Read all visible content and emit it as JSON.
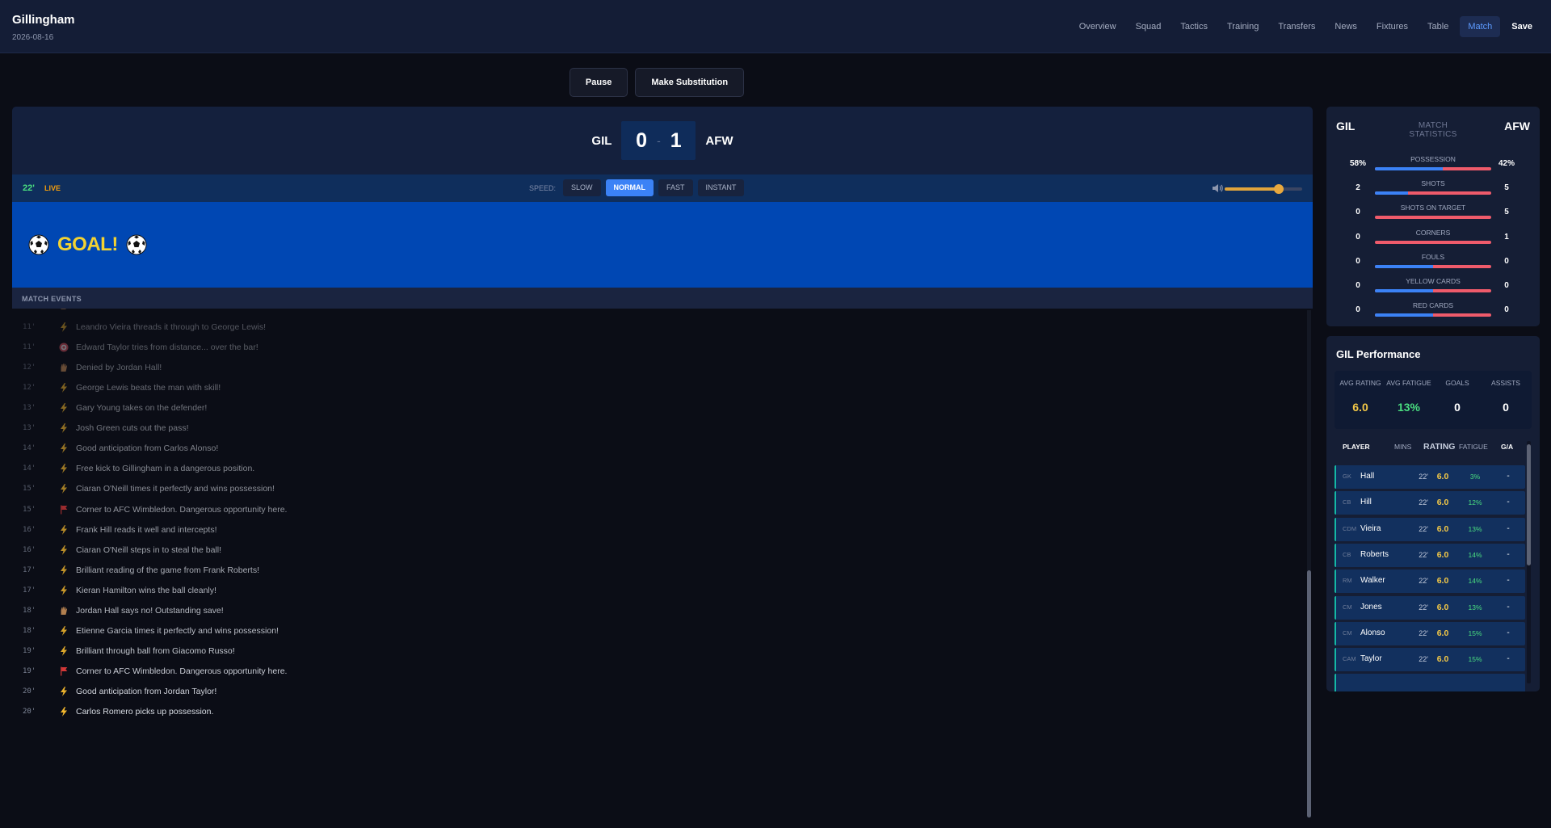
{
  "header": {
    "club_name": "Gillingham",
    "date": "2026-08-16",
    "nav": [
      "Overview",
      "Squad",
      "Tactics",
      "Training",
      "Transfers",
      "News",
      "Fixtures",
      "Table",
      "Match",
      "Save"
    ],
    "active_nav": "Match"
  },
  "controls": {
    "pause_label": "Pause",
    "substitution_label": "Make Substitution"
  },
  "match": {
    "home_code": "GIL",
    "away_code": "AFW",
    "home_score": "0",
    "score_separator": "-",
    "away_score": "1",
    "minute": "22'",
    "live_label": "LIVE",
    "speed_label": "SPEED:",
    "speeds": [
      "SLOW",
      "NORMAL",
      "FAST",
      "INSTANT"
    ],
    "active_speed": "NORMAL",
    "volume_level": 0.7,
    "goal_text": "GOAL!",
    "events_title": "MATCH EVENTS"
  },
  "events": [
    {
      "min": "11'",
      "icon": "bolt-icon",
      "text": "Leandro Vieira threads it through to George Lewis!"
    },
    {
      "min": "11'",
      "icon": "target-icon",
      "text": "Edward Taylor tries from distance... over the bar!"
    },
    {
      "min": "12'",
      "icon": "glove-icon",
      "text": "Denied by Jordan Hall!"
    },
    {
      "min": "12'",
      "icon": "bolt-icon",
      "text": "George Lewis beats the man with skill!"
    },
    {
      "min": "13'",
      "icon": "bolt-icon",
      "text": "Gary Young takes on the defender!"
    },
    {
      "min": "13'",
      "icon": "bolt-icon",
      "text": "Josh Green cuts out the pass!"
    },
    {
      "min": "14'",
      "icon": "bolt-icon",
      "text": "Good anticipation from Carlos Alonso!"
    },
    {
      "min": "14'",
      "icon": "bolt-icon",
      "text": "Free kick to Gillingham in a dangerous position."
    },
    {
      "min": "15'",
      "icon": "bolt-icon",
      "text": "Ciaran O'Neill times it perfectly and wins possession!"
    },
    {
      "min": "15'",
      "icon": "flag-icon",
      "text": "Corner to AFC Wimbledon. Dangerous opportunity here."
    },
    {
      "min": "16'",
      "icon": "bolt-icon",
      "text": "Frank Hill reads it well and intercepts!"
    },
    {
      "min": "16'",
      "icon": "bolt-icon",
      "text": "Ciaran O'Neill steps in to steal the ball!"
    },
    {
      "min": "17'",
      "icon": "bolt-icon",
      "text": "Brilliant reading of the game from Frank Roberts!"
    },
    {
      "min": "17'",
      "icon": "bolt-icon",
      "text": "Kieran Hamilton wins the ball cleanly!"
    },
    {
      "min": "18'",
      "icon": "glove-icon",
      "text": "Jordan Hall says no! Outstanding save!"
    },
    {
      "min": "18'",
      "icon": "bolt-icon",
      "text": "Etienne Garcia times it perfectly and wins possession!"
    },
    {
      "min": "19'",
      "icon": "bolt-icon",
      "text": "Brilliant through ball from Giacomo Russo!"
    },
    {
      "min": "19'",
      "icon": "flag-icon",
      "text": "Corner to AFC Wimbledon. Dangerous opportunity here."
    },
    {
      "min": "20'",
      "icon": "bolt-icon",
      "text": "Good anticipation from Jordan Taylor!"
    },
    {
      "min": "20'",
      "icon": "bolt-icon",
      "text": "Carlos Romero picks up possession."
    }
  ],
  "stats": {
    "home": "GIL",
    "title": "MATCH STATISTICS",
    "away": "AFW",
    "rows": [
      {
        "name": "POSSESSION",
        "home": "58%",
        "away": "42%",
        "home_share": 0.58
      },
      {
        "name": "SHOTS",
        "home": "2",
        "away": "5",
        "home_share": 0.2857
      },
      {
        "name": "SHOTS ON TARGET",
        "home": "0",
        "away": "5",
        "home_share": 0
      },
      {
        "name": "CORNERS",
        "home": "0",
        "away": "1",
        "home_share": 0
      },
      {
        "name": "FOULS",
        "home": "0",
        "away": "0",
        "home_share": 0.5
      },
      {
        "name": "YELLOW CARDS",
        "home": "0",
        "away": "0",
        "home_share": 0.5
      },
      {
        "name": "RED CARDS",
        "home": "0",
        "away": "0",
        "home_share": 0.5
      }
    ]
  },
  "performance": {
    "title": "GIL Performance",
    "avg_rating_label": "AVG RATING",
    "avg_rating": "6.0",
    "avg_fatigue_label": "AVG FATIGUE",
    "avg_fatigue": "13%",
    "goals_label": "GOALS",
    "goals": "0",
    "assists_label": "ASSISTS",
    "assists": "0",
    "columns": {
      "player": "PLAYER",
      "mins": "MINS",
      "rating": "RATING",
      "fatigue": "FATIGUE",
      "ga": "G/A"
    },
    "players": [
      {
        "pos": "GK",
        "name": "Hall",
        "mins": "22'",
        "rating": "6.0",
        "fatigue": "3%",
        "ga": "-"
      },
      {
        "pos": "CB",
        "name": "Hill",
        "mins": "22'",
        "rating": "6.0",
        "fatigue": "12%",
        "ga": "-"
      },
      {
        "pos": "CDM",
        "name": "Vieira",
        "mins": "22'",
        "rating": "6.0",
        "fatigue": "13%",
        "ga": "-"
      },
      {
        "pos": "CB",
        "name": "Roberts",
        "mins": "22'",
        "rating": "6.0",
        "fatigue": "14%",
        "ga": "-"
      },
      {
        "pos": "RM",
        "name": "Walker",
        "mins": "22'",
        "rating": "6.0",
        "fatigue": "14%",
        "ga": "-"
      },
      {
        "pos": "CM",
        "name": "Jones",
        "mins": "22'",
        "rating": "6.0",
        "fatigue": "13%",
        "ga": "-"
      },
      {
        "pos": "CM",
        "name": "Alonso",
        "mins": "22'",
        "rating": "6.0",
        "fatigue": "15%",
        "ga": "-"
      },
      {
        "pos": "CAM",
        "name": "Taylor",
        "mins": "22'",
        "rating": "6.0",
        "fatigue": "15%",
        "ga": "-"
      }
    ]
  },
  "colors": {
    "accent": "#3b82f6",
    "away_bar": "#ef5b6b",
    "gold": "#f3c847",
    "green": "#4ade80",
    "goal_banner": "#0047b3"
  }
}
